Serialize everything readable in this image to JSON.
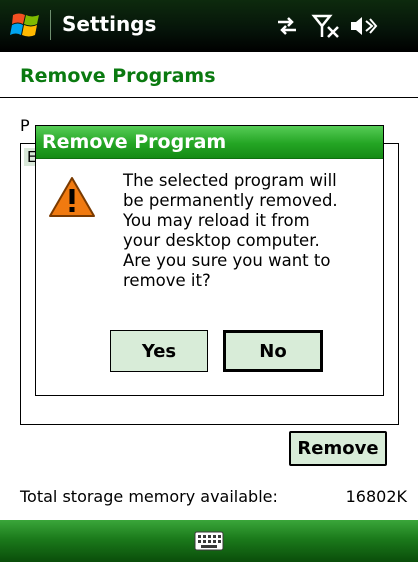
{
  "titlebar": {
    "title": "Settings",
    "icons": [
      "windows-start-icon",
      "connectivity-icon",
      "signal-off-icon",
      "volume-off-icon"
    ]
  },
  "page": {
    "title": "Remove Programs",
    "label_fragment": "P",
    "list_item_fragment": "E"
  },
  "dialog": {
    "title": "Remove Program",
    "message_lines": [
      "The selected program will",
      "be permanently removed.",
      "You may reload it from",
      "your desktop computer.",
      "Are you sure you want to",
      "remove it?"
    ],
    "yes_label": "Yes",
    "no_label": "No",
    "icon": "warning-icon"
  },
  "remove_button": {
    "label": "Remove"
  },
  "storage": {
    "label": "Total storage memory available:",
    "value": "16802K"
  },
  "bottombar": {
    "icon": "keyboard-icon"
  },
  "colors": {
    "accent_green": "#0a7a10",
    "dialog_title_green": "#24a524",
    "button_fill": "#d8ecd8",
    "warning_orange": "#f07a10"
  }
}
